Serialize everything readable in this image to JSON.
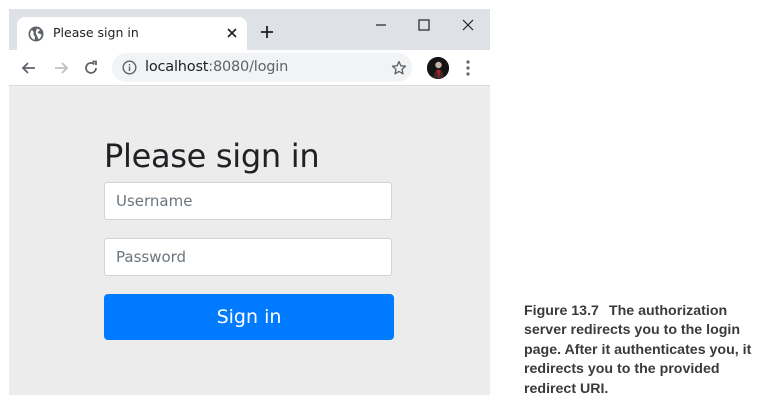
{
  "browser": {
    "tab": {
      "title": "Please sign in"
    },
    "address_bar": {
      "host": "localhost",
      "rest": ":8080/login"
    }
  },
  "page": {
    "title": "Please sign in",
    "username": {
      "placeholder": "Username",
      "value": ""
    },
    "password": {
      "placeholder": "Password",
      "value": ""
    },
    "signin_label": "Sign in",
    "primary_color": "#007bff"
  },
  "caption": {
    "label": "Figure 13.7",
    "text": "The authorization server redirects you to the login page. After it authenticates you, it redirects you to the provided redirect URI."
  },
  "icons": [
    "globe-icon",
    "close-icon",
    "plus-icon",
    "minimize-icon",
    "maximize-icon",
    "window-close-icon",
    "back-arrow-icon",
    "forward-arrow-icon",
    "reload-icon",
    "info-icon",
    "star-icon",
    "avatar",
    "menu-dots-icon"
  ]
}
